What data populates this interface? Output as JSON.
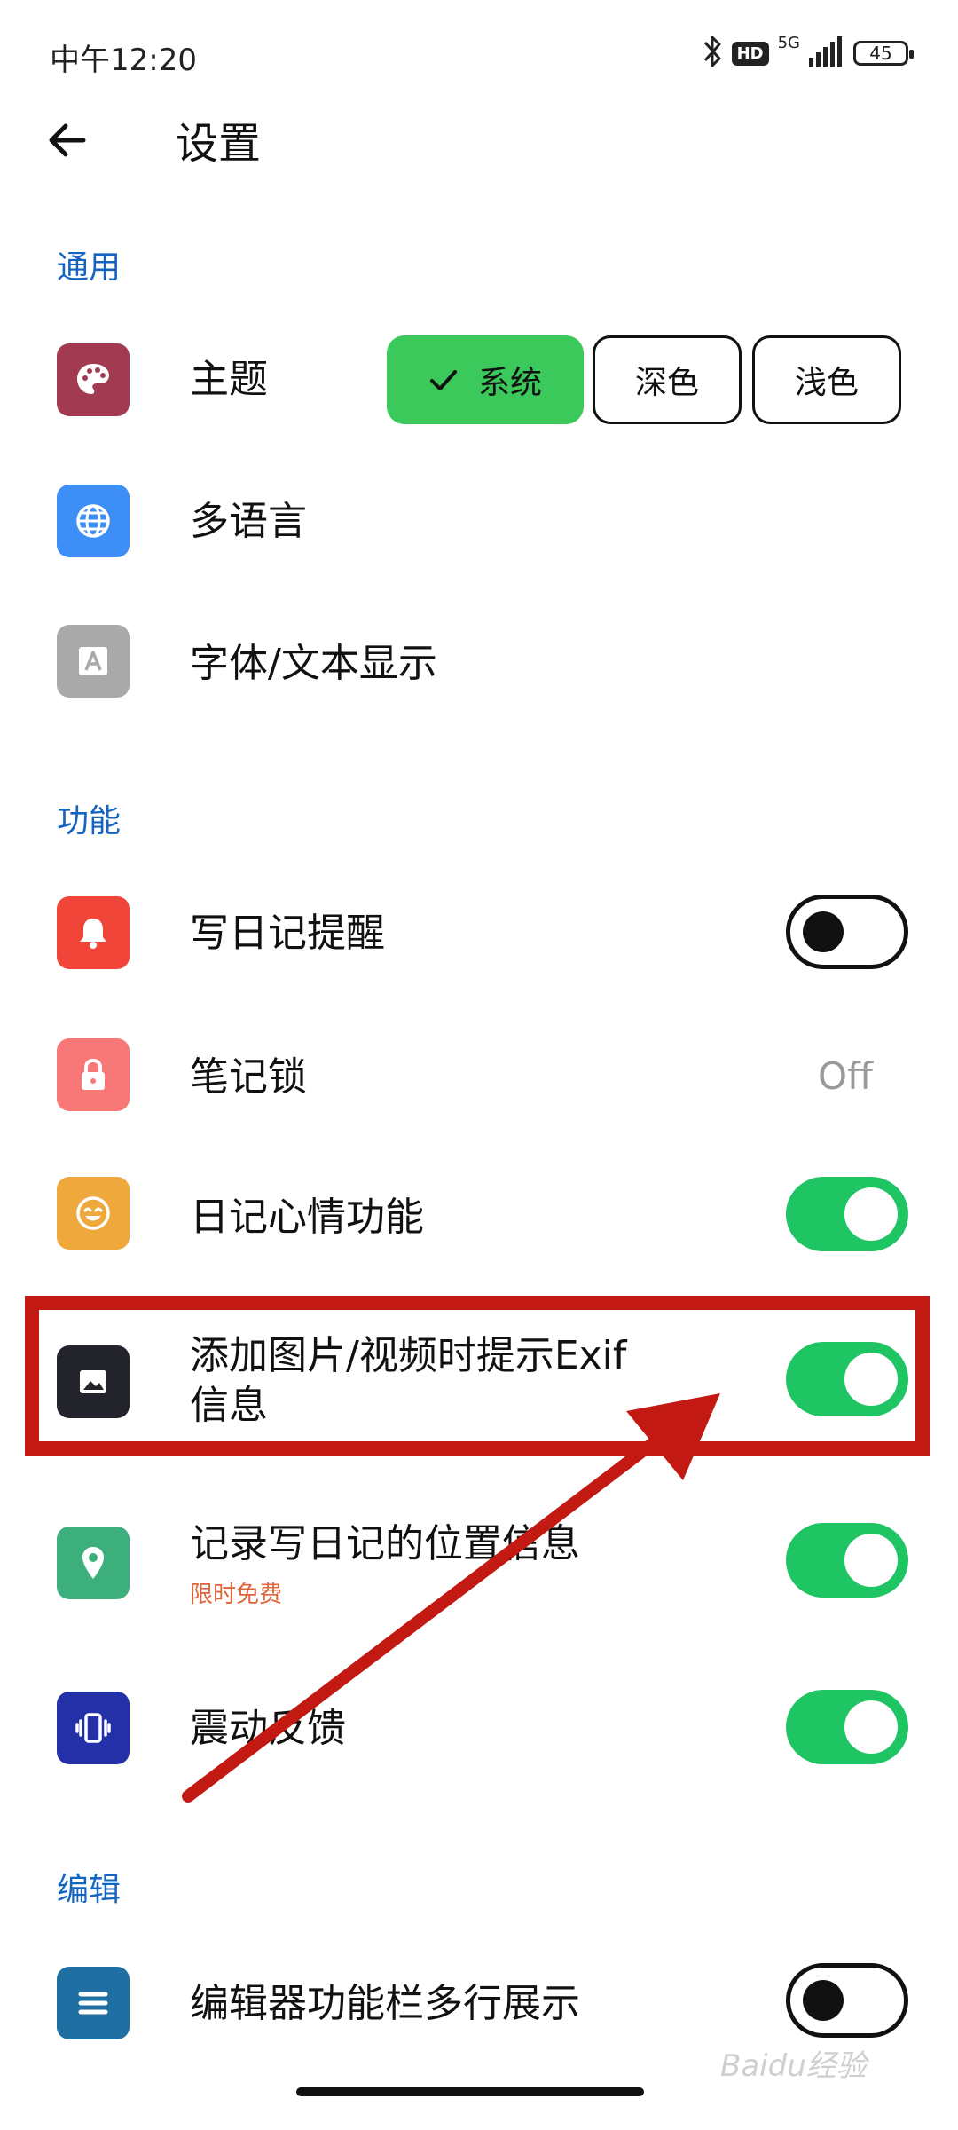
{
  "status_bar": {
    "time": "中午12:20",
    "hd_label": "HD",
    "network_label": "5G",
    "battery_level": "45"
  },
  "header": {
    "title": "设置"
  },
  "sections": {
    "general": "通用",
    "features": "功能",
    "editing": "编辑"
  },
  "theme": {
    "label": "主题",
    "options": [
      "系统",
      "深色",
      "浅色"
    ],
    "selected": "系统"
  },
  "items": {
    "language": {
      "label": "多语言"
    },
    "font": {
      "label": "字体/文本显示"
    },
    "reminder": {
      "label": "写日记提醒",
      "enabled": false
    },
    "note_lock": {
      "label": "笔记锁",
      "value": "Off"
    },
    "mood": {
      "label": "日记心情功能",
      "enabled": true
    },
    "exif": {
      "label_line1": "添加图片/视频时提示Exif",
      "label_line2": "信息",
      "enabled": true
    },
    "location": {
      "label": "记录写日记的位置信息",
      "badge": "限时免费",
      "enabled": true
    },
    "vibration": {
      "label": "震动反馈",
      "enabled": true
    },
    "toolbar_multiline": {
      "label": "编辑器功能栏多行展示",
      "enabled": false
    }
  },
  "colors": {
    "accent_blue": "#1565c0",
    "toggle_on": "#1fc463",
    "chip_selected": "#3ac95a",
    "annotation_red": "#c21a12",
    "promo_orange": "#e0643a"
  },
  "watermark": "Baidu经验"
}
